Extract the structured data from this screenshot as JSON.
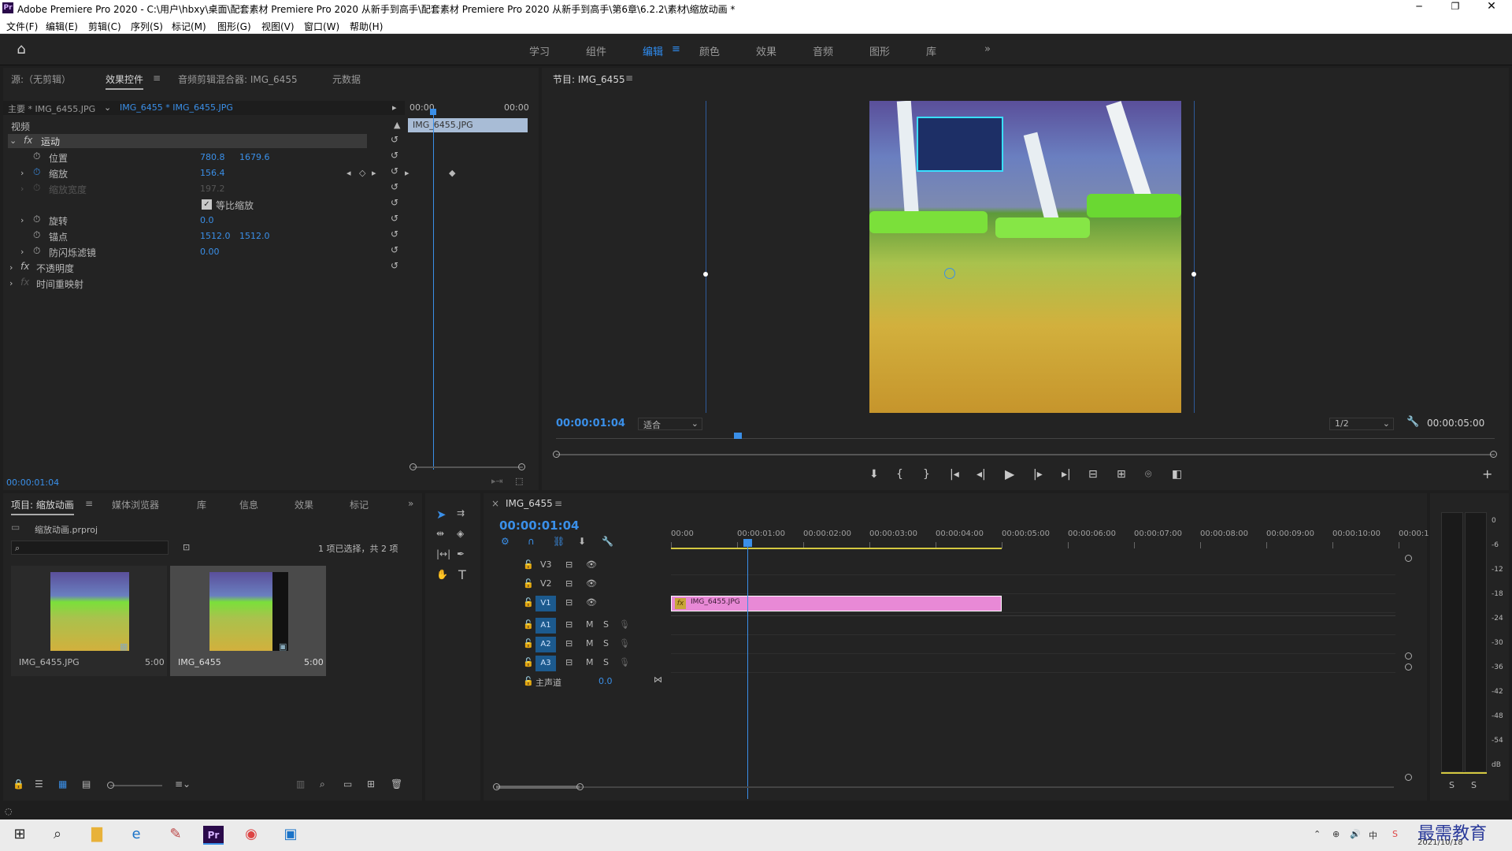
{
  "window": {
    "title": "Adobe Premiere Pro 2020 - C:\\用户\\hbxy\\桌面\\配套素材 Premiere Pro 2020 从新手到高手\\配套素材 Premiere Pro 2020 从新手到高手\\第6章\\6.2.2\\素材\\缩放动画 *",
    "app_badge": "Pr"
  },
  "menu": [
    "文件(F)",
    "编辑(E)",
    "剪辑(C)",
    "序列(S)",
    "标记(M)",
    "图形(G)",
    "视图(V)",
    "窗口(W)",
    "帮助(H)"
  ],
  "workspaces": {
    "items": [
      "学习",
      "组件",
      "编辑",
      "颜色",
      "效果",
      "音频",
      "图形",
      "库"
    ],
    "active": "编辑",
    "more": "»"
  },
  "effect_panel": {
    "tabs": [
      "源:（无剪辑）",
      "效果控件",
      "音频剪辑混合器: IMG_6455",
      "元数据"
    ],
    "active_tab": "效果控件",
    "master_label": "主要 * IMG_6455.JPG",
    "clip_label": "IMG_6455 * IMG_6455.JPG",
    "timecode_start": "00:00",
    "timecode_end": "00:00",
    "clip_bar_label": "IMG_6455.JPG",
    "section_video": "视频",
    "motion": "运动",
    "properties": [
      {
        "name": "位置",
        "v1": "780.8",
        "v2": "1679.6"
      },
      {
        "name": "缩放",
        "v1": "156.4",
        "v2": ""
      },
      {
        "name": "缩放宽度",
        "v1": "197.2",
        "v2": ""
      },
      {
        "name": "等比缩放",
        "v1": "",
        "v2": ""
      },
      {
        "name": "旋转",
        "v1": "0.0",
        "v2": ""
      },
      {
        "name": "锚点",
        "v1": "1512.0",
        "v2": "1512.0"
      },
      {
        "name": "防闪烁滤镜",
        "v1": "0.00",
        "v2": ""
      }
    ],
    "opacity": "不透明度",
    "time_remap": "时间重映射",
    "current_time": "00:00:01:04"
  },
  "program_monitor": {
    "title": "节目: IMG_6455",
    "timecode": "00:00:01:04",
    "fit": "适合",
    "resolution": "1/2",
    "duration": "00:00:05:00"
  },
  "project_panel": {
    "tabs": [
      "项目: 缩放动画",
      "媒体浏览器",
      "库",
      "信息",
      "效果",
      "标记"
    ],
    "active_tab": "项目: 缩放动画",
    "project_file": "缩放动画.prproj",
    "selection_info": "1 项已选择，共 2 项",
    "search_placeholder": "",
    "items": [
      {
        "name": "IMG_6455.JPG",
        "duration": "5:00"
      },
      {
        "name": "IMG_6455",
        "duration": "5:00"
      }
    ]
  },
  "timeline": {
    "sequence": "IMG_6455",
    "timecode": "00:00:01:04",
    "ruler": [
      "00:00",
      "00:00:01:00",
      "00:00:02:00",
      "00:00:03:00",
      "00:00:04:00",
      "00:00:05:00",
      "00:00:06:00",
      "00:00:07:00",
      "00:00:08:00",
      "00:00:09:00",
      "00:00:10:00",
      "00:00:1"
    ],
    "video_tracks": [
      "V3",
      "V2",
      "V1"
    ],
    "audio_tracks": [
      "A1",
      "A2",
      "A3"
    ],
    "master": "主声道",
    "master_value": "0.0",
    "mute": "M",
    "solo": "S",
    "clip_label": "IMG_6455.JPG",
    "clip_fx": "fx",
    "clip_color": "#e889d6",
    "playhead_seconds": 1.16,
    "clip_end_seconds": 5.0
  },
  "audio_meter": {
    "scale": [
      "0",
      "-6",
      "-12",
      "-18",
      "-24",
      "-30",
      "-36",
      "-42",
      "-48",
      "-54",
      "dB"
    ],
    "solo_buttons": [
      "S",
      "S"
    ]
  },
  "taskbar": {
    "date": "2021/10/18",
    "watermark": "最需教育"
  },
  "colors": {
    "accent": "#2f8cf0",
    "panel_bg": "#232323",
    "app_bg": "#1e1e1e"
  }
}
